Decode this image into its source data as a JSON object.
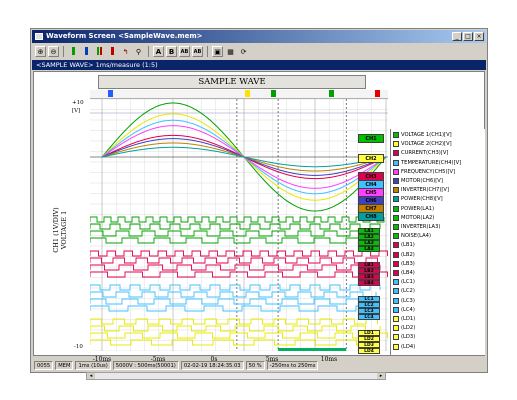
{
  "window": {
    "title": "Waveform Screen <SampleWave.mem>",
    "info": "<SAMPLE WAVE> 1ms/measure (1:5)",
    "buttons": [
      "_",
      "□",
      "×"
    ]
  },
  "toolbar": {
    "icons": [
      "zoom-in-icon",
      "zoom-out-icon",
      "cursor-a-icon",
      "cursor-b-icon",
      "cursor-both-icon",
      "cursor-move-icon",
      "search-icon",
      "label-a-icon",
      "label-b-icon",
      "label-ab-icon",
      "label-ab2-icon",
      "display-icon",
      "grid-icon",
      "refresh-icon"
    ]
  },
  "chart": {
    "banner": "SAMPLE WAVE",
    "y_top": "+10",
    "y_unit": "[V]",
    "y_bottom": "-10",
    "y_title_1": "CH1 (1V/DIV)",
    "y_title_2": "VOLTAGE 1",
    "x_labels": [
      "-10ms",
      "-5ms",
      "0s",
      "5ms",
      "10ms"
    ],
    "analog_tags": [
      {
        "label": "CH1",
        "color": "#00c000"
      },
      {
        "label": "CH2",
        "color": "#ffff40"
      },
      {
        "label": "CH3",
        "color": "#e00050"
      },
      {
        "label": "CH4",
        "color": "#40c0ff"
      },
      {
        "label": "CH5",
        "color": "#ff40ff"
      },
      {
        "label": "CH6",
        "color": "#4040c0"
      },
      {
        "label": "CH7",
        "color": "#c08000"
      },
      {
        "label": "CH8",
        "color": "#00a0a0"
      }
    ],
    "logic_tags": [
      "LA1",
      "LA2",
      "LA3",
      "LA4",
      "LB1",
      "LB2",
      "LB3",
      "LB4",
      "LC1",
      "LC2",
      "LC3",
      "LC4",
      "LD1",
      "LD2",
      "LD3",
      "LD4"
    ]
  },
  "chart_data": {
    "type": "line",
    "title": "SAMPLE WAVE",
    "ylabel": "CH1 (1V/DIV) VOLTAGE 1",
    "x_ticks": [
      "-10ms",
      "-5ms",
      "0s",
      "5ms",
      "10ms"
    ],
    "xlim_ms": [
      -10,
      10
    ],
    "ylim": [
      -10,
      10
    ],
    "x_ms": [
      -10,
      -5,
      0,
      5,
      10
    ],
    "series": [
      {
        "name": "VOLTAGE 1(CH1)[V]",
        "color": "#00a000",
        "amplitude": 10
      },
      {
        "name": "VOLTAGE 2(CH2)[V]",
        "color": "#e8e800",
        "amplitude": 8
      },
      {
        "name": "CURRENT(CH3)[V]",
        "color": "#e00050",
        "amplitude": 4
      },
      {
        "name": "TEMPERATURE(CH4)[V]",
        "color": "#40c0ff",
        "amplitude": 6.8
      },
      {
        "name": "FREQUENCY(CH5)[V]",
        "color": "#ff40ff",
        "amplitude": 5.8
      },
      {
        "name": "MOTOR(CH6)[V]",
        "color": "#4040c0",
        "amplitude": 3.4
      },
      {
        "name": "INVERTER(CH7)[V]",
        "color": "#c08000",
        "amplitude": 2.6
      },
      {
        "name": "POWER(CH8)[V]",
        "color": "#00a0a0",
        "amplitude": 1.8
      }
    ],
    "grid": true
  },
  "legend": {
    "items": [
      {
        "label": "VOLTAGE 1(CH1)[V]",
        "color": "#00c000"
      },
      {
        "label": "VOLTAGE 2(CH2)[V]",
        "color": "#ffff40"
      },
      {
        "label": "CURRENT(CH3)[V]",
        "color": "#e00050"
      },
      {
        "label": "TEMPERATURE(CH4)[V]",
        "color": "#40c0ff"
      },
      {
        "label": "FREQUENCY(CH5)[V]",
        "color": "#ff40ff"
      },
      {
        "label": "MOTOR(CH6)[V]",
        "color": "#4040c0"
      },
      {
        "label": "INVERTER(CH7)[V]",
        "color": "#c08000"
      },
      {
        "label": "POWER(CH8)[V]",
        "color": "#00a0a0"
      },
      {
        "label": "POWER(LA1)",
        "color": "#00c000"
      },
      {
        "label": "MOTOR(LA2)",
        "color": "#00c000"
      },
      {
        "label": "INVERTER(LA3)",
        "color": "#00c000"
      },
      {
        "label": "NOISE(LA4)",
        "color": "#00c000"
      },
      {
        "label": "(LB1)",
        "color": "#e00050"
      },
      {
        "label": "(LB2)",
        "color": "#e00050"
      },
      {
        "label": "(LB3)",
        "color": "#e00050"
      },
      {
        "label": "(LB4)",
        "color": "#e00050"
      },
      {
        "label": "(LC1)",
        "color": "#40c0ff"
      },
      {
        "label": "(LC2)",
        "color": "#40c0ff"
      },
      {
        "label": "(LC3)",
        "color": "#40c0ff"
      },
      {
        "label": "(LC4)",
        "color": "#40c0ff"
      },
      {
        "label": "(LD1)",
        "color": "#ffff40"
      },
      {
        "label": "(LD2)",
        "color": "#ffff40"
      },
      {
        "label": "(LD3)",
        "color": "#ffff40"
      },
      {
        "label": "(LD4)",
        "color": "#ffff40"
      }
    ]
  },
  "status": {
    "items": [
      "0055",
      "MEM",
      "1ms (10us)",
      "5000V : 500ms(50001)",
      "02-02-19 18:24:35.03",
      "50 %",
      "-250ms to 250ms"
    ]
  }
}
